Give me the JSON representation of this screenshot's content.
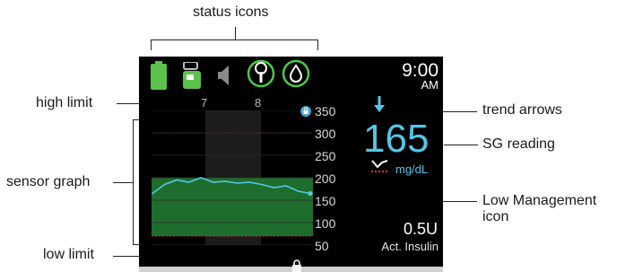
{
  "callouts": {
    "status_icons": "status icons",
    "high_limit": "high limit",
    "sensor_graph": "sensor graph",
    "low_limit": "low limit",
    "trend_arrows": "trend arrows",
    "sg_reading": "SG reading",
    "low_management_line1": "Low Management",
    "low_management_line2": "icon"
  },
  "screen": {
    "time": "9:00",
    "ampm": "AM",
    "sg_value": "165",
    "sg_unit": "mg/dL",
    "insulin_value": "0.5U",
    "insulin_label": "Act. Insulin",
    "x_ticks": [
      "7",
      "8"
    ],
    "y_ticks": [
      "350",
      "300",
      "250",
      "200",
      "150",
      "100",
      "50"
    ],
    "status_icons": [
      "battery-icon",
      "reservoir-icon",
      "speaker-icon",
      "sensor-connection-icon",
      "calibration-icon"
    ],
    "colors": {
      "sg_value": "#52c7e6",
      "battery": "#5cc34a",
      "status_ring": "#4cc944",
      "trend_line": "#52c7e6",
      "target_band": "#1f6d2c"
    }
  },
  "chart_data": {
    "type": "line",
    "y_unit": "mg/dL",
    "ylim": [
      50,
      350
    ],
    "y_ticks": [
      350,
      300,
      250,
      200,
      150,
      100,
      50
    ],
    "x_ticks": [
      "7",
      "8"
    ],
    "high_limit": 300,
    "low_limit": 70,
    "series": [
      {
        "values": [
          165,
          185,
          195,
          190,
          200,
          190,
          192,
          188,
          190,
          185,
          178,
          182,
          170,
          165
        ]
      }
    ]
  }
}
